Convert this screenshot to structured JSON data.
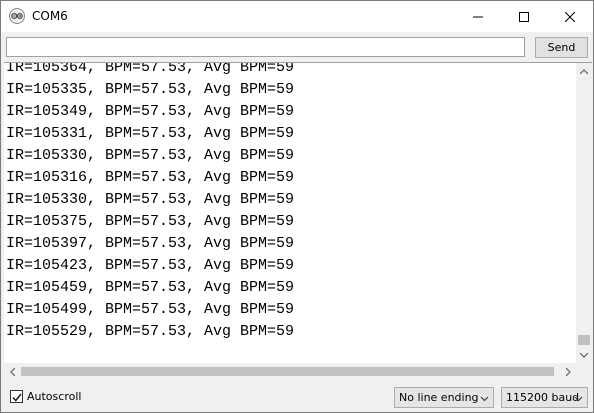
{
  "window": {
    "title": "COM6"
  },
  "send_row": {
    "input_value": "",
    "send_label": "Send"
  },
  "output": {
    "lines": [
      "IR=105364, BPM=57.53, Avg BPM=59",
      "IR=105335, BPM=57.53, Avg BPM=59",
      "IR=105349, BPM=57.53, Avg BPM=59",
      "IR=105331, BPM=57.53, Avg BPM=59",
      "IR=105330, BPM=57.53, Avg BPM=59",
      "IR=105316, BPM=57.53, Avg BPM=59",
      "IR=105330, BPM=57.53, Avg BPM=59",
      "IR=105375, BPM=57.53, Avg BPM=59",
      "IR=105397, BPM=57.53, Avg BPM=59",
      "IR=105423, BPM=57.53, Avg BPM=59",
      "IR=105459, BPM=57.53, Avg BPM=59",
      "IR=105499, BPM=57.53, Avg BPM=59",
      "IR=105529, BPM=57.53, Avg BPM=59"
    ]
  },
  "statusbar": {
    "autoscroll_label": "Autoscroll",
    "autoscroll_checked": true,
    "line_ending": "No line ending",
    "baud": "115200 baud"
  },
  "icons": {
    "app": "arduino-icon",
    "minimize": "minimize-icon",
    "maximize": "maximize-icon",
    "close": "close-icon",
    "checkmark": "checkmark-icon",
    "dropdown": "chevron-down-icon"
  },
  "colors": {
    "window_bg": "#f0f0f0",
    "output_bg": "#ffffff",
    "border": "#7a7a7a"
  }
}
